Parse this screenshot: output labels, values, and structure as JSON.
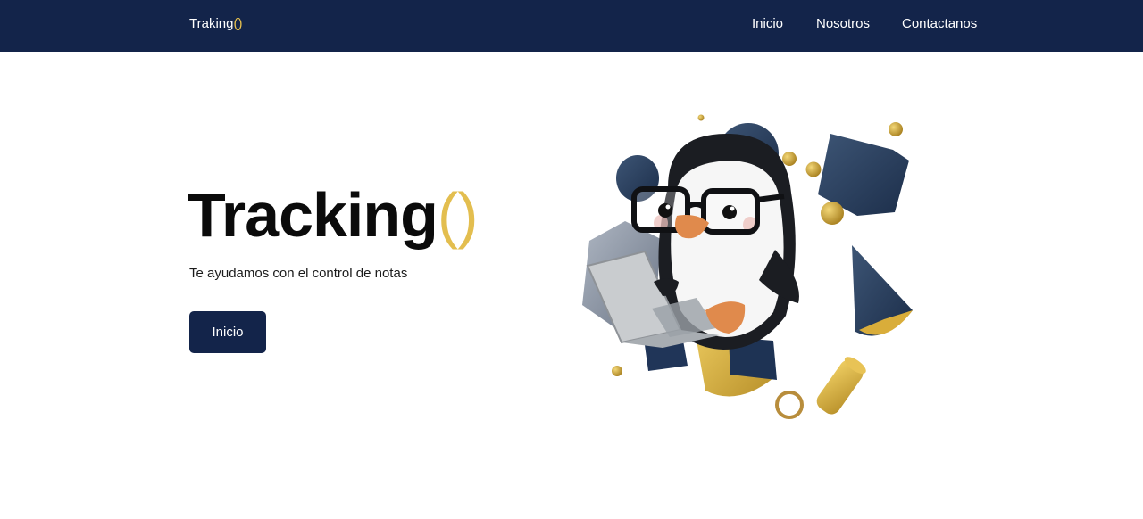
{
  "navbar": {
    "brand": {
      "text": "Traking",
      "paren": "()"
    },
    "links": [
      {
        "label": "Inicio"
      },
      {
        "label": "Nosotros"
      },
      {
        "label": "Contactanos"
      }
    ],
    "colors": {
      "background": "#13244a",
      "accent": "#e9c24e"
    }
  },
  "hero": {
    "title": "Tracking",
    "title_paren": "()",
    "subtitle": "Te ayudamos con el control de notas",
    "button_label": "Inicio"
  },
  "illustration": {
    "subject": "penguin-with-glasses-using-laptop-icon"
  }
}
